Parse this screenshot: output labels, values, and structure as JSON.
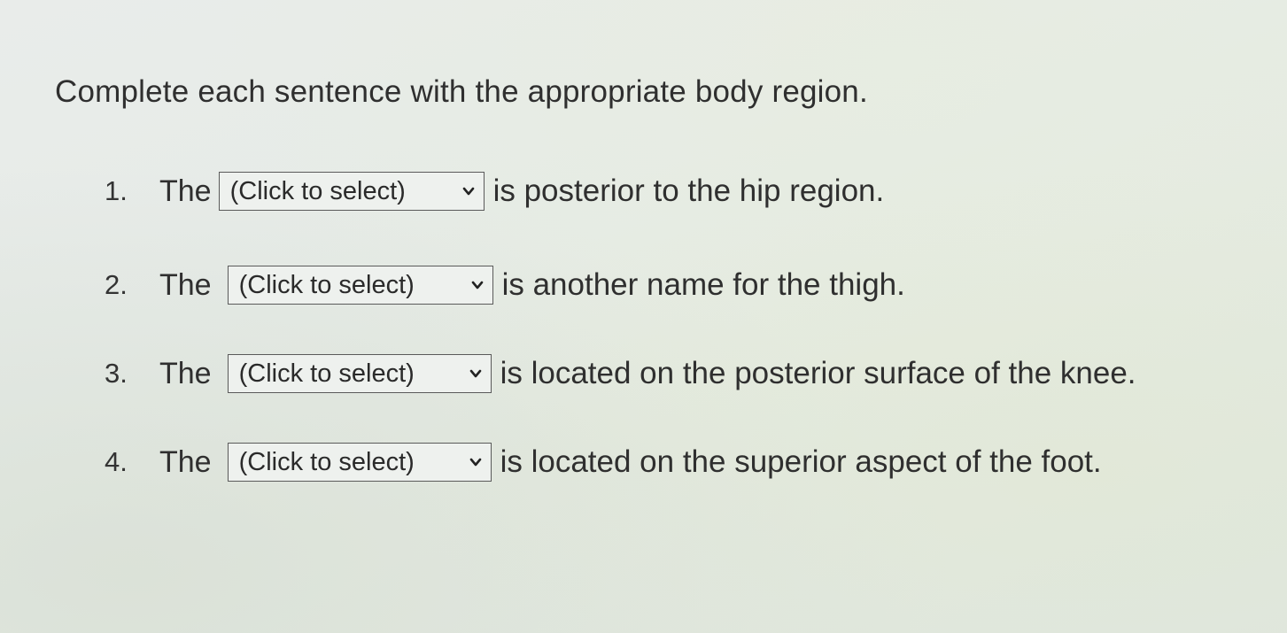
{
  "instruction": "Complete each sentence with the appropriate body region.",
  "questions": [
    {
      "number": "1.",
      "lead": "The",
      "select_value": "(Click to select)",
      "tail": "is posterior to the hip region."
    },
    {
      "number": "2.",
      "lead": "The",
      "select_value": "(Click to select)",
      "tail": "is another name for the thigh."
    },
    {
      "number": "3.",
      "lead": "The",
      "select_value": "(Click to select)",
      "tail": "is located on the posterior surface of the knee."
    },
    {
      "number": "4.",
      "lead": "The",
      "select_value": "(Click to select)",
      "tail": "is located on the superior aspect of the foot."
    }
  ],
  "icons": {
    "dropdown": "chevron-down-icon"
  },
  "colors": {
    "text": "#2f2f2f",
    "select_border": "#5a5a5a"
  }
}
